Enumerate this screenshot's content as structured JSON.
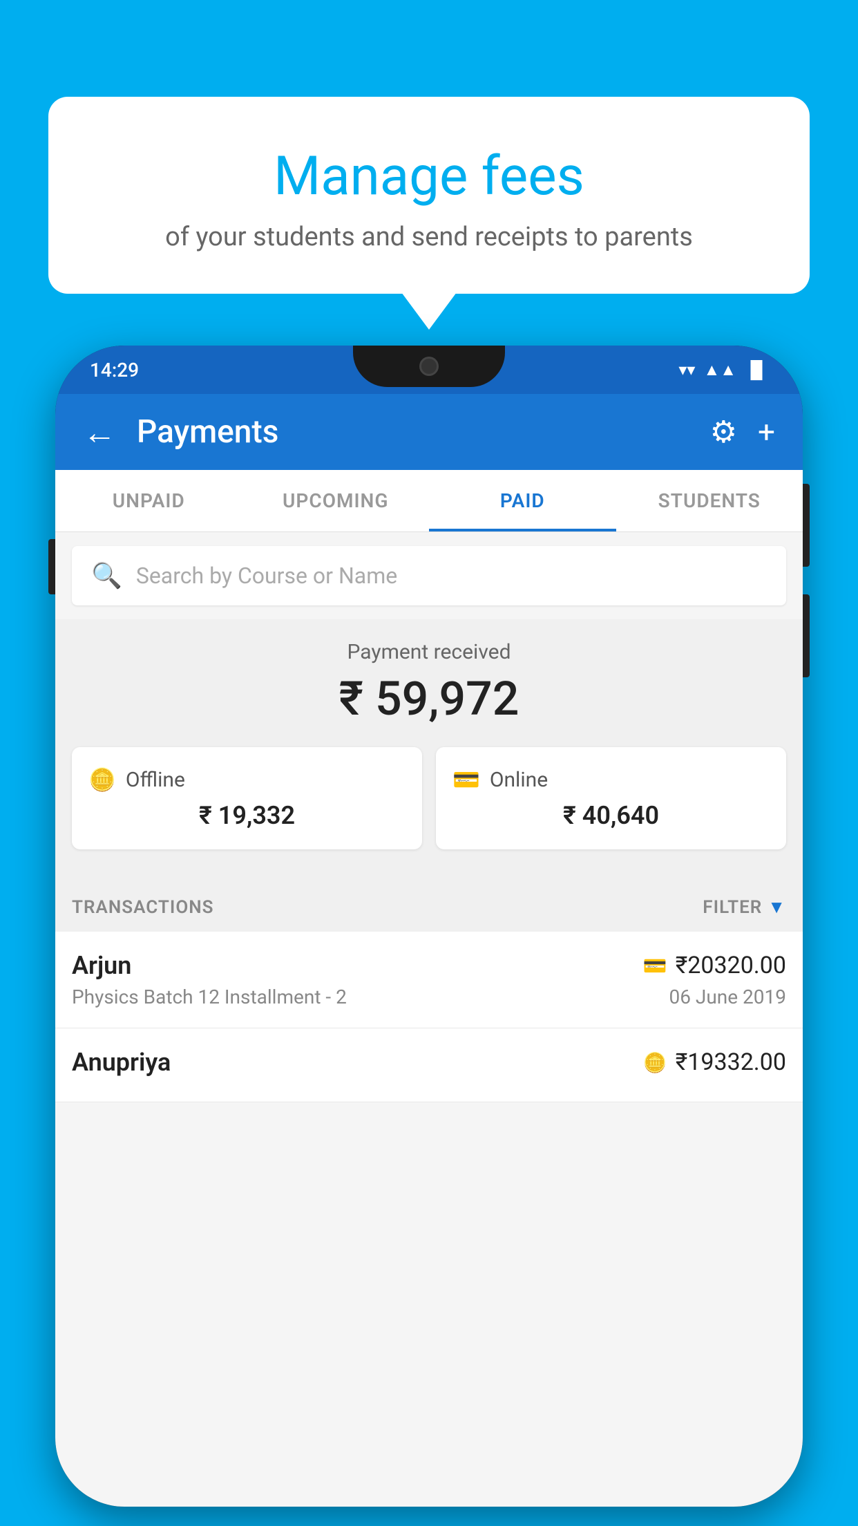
{
  "background_color": "#00AEEF",
  "speech_bubble": {
    "title": "Manage fees",
    "subtitle": "of your students and send receipts to parents"
  },
  "status_bar": {
    "time": "14:29",
    "wifi": "▼",
    "signal": "▲",
    "battery": "▐"
  },
  "header": {
    "title": "Payments",
    "back_label": "←",
    "settings_icon": "⚙",
    "add_icon": "+"
  },
  "tabs": [
    {
      "label": "UNPAID",
      "active": false
    },
    {
      "label": "UPCOMING",
      "active": false
    },
    {
      "label": "PAID",
      "active": true
    },
    {
      "label": "STUDENTS",
      "active": false
    }
  ],
  "search": {
    "placeholder": "Search by Course or Name"
  },
  "payment_summary": {
    "label": "Payment received",
    "total": "₹ 59,972",
    "offline": {
      "label": "Offline",
      "amount": "₹ 19,332"
    },
    "online": {
      "label": "Online",
      "amount": "₹ 40,640"
    }
  },
  "transactions_section": {
    "label": "TRANSACTIONS",
    "filter_label": "FILTER"
  },
  "transactions": [
    {
      "name": "Arjun",
      "detail": "Physics Batch 12 Installment - 2",
      "amount": "₹20320.00",
      "date": "06 June 2019",
      "payment_type": "card"
    },
    {
      "name": "Anupriya",
      "detail": "",
      "amount": "₹19332.00",
      "date": "",
      "payment_type": "cash"
    }
  ]
}
